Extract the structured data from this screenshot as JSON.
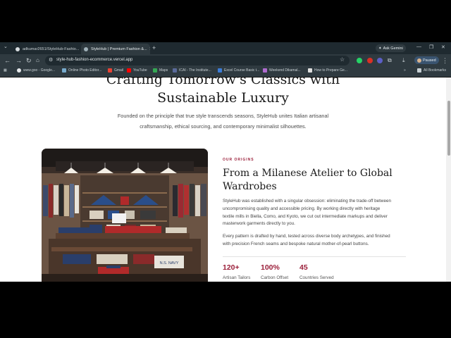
{
  "browser": {
    "tabs": [
      {
        "title": "adkumar2651/StyleHub-Fashio..."
      },
      {
        "title": "StyleHub | Premium Fashion &..."
      }
    ],
    "new_tab": "+",
    "ask_gemini": "Ask Gemini",
    "url": "style-hub-fashion-ecommerce.vercel.app",
    "profile": "Paused",
    "bookmarks": [
      {
        "label": "www.goo - Google..."
      },
      {
        "label": "Online Photo Editor..."
      },
      {
        "label": "Gmail"
      },
      {
        "label": "YouTube"
      },
      {
        "label": "Maps"
      },
      {
        "label": "ICAI - The Institute..."
      },
      {
        "label": "Excel Course Basic t..."
      },
      {
        "label": "Weekend Dikamal..."
      },
      {
        "label": "How to Prepare Ge..."
      }
    ],
    "all_bookmarks": "All Bookmarks"
  },
  "hero": {
    "title_line1": "Crafting Tomorrow's Classics with",
    "title_line2": "Sustainable Luxury",
    "subtitle_line1": "Founded on the principle that true style transcends seasons, StyleHub unites Italian artisanal",
    "subtitle_line2": "craftsmanship, ethical sourcing, and contemporary minimalist silhouettes."
  },
  "origins": {
    "eyebrow": "OUR ORIGINS",
    "heading_line1": "From a Milanese Atelier to Global",
    "heading_line2": "Wardrobes",
    "para1": [
      "StyleHub was established with a singular obsession: eliminating the trade-off between",
      "uncompromising quality and accessible pricing. By working directly with heritage",
      "textile mills in Biella, Como, and Kyoto, we cut out intermediate markups and deliver",
      "masterwork garments directly to you."
    ],
    "para2": [
      "Every pattern is drafted by hand, tested across diverse body archetypes, and finished",
      "with precision French seams and bespoke natural mother-of-pearl buttons."
    ],
    "image_sign": "N.S. NAVY",
    "stats": [
      {
        "value": "120+",
        "label": "Artisan Tailors"
      },
      {
        "value": "100%",
        "label": "Carbon Offset"
      },
      {
        "value": "45",
        "label": "Countries Served"
      }
    ]
  },
  "colors": {
    "accent": "#9b1f3a",
    "chrome_dark": "#1f2a30",
    "chrome": "#2f3a40"
  }
}
